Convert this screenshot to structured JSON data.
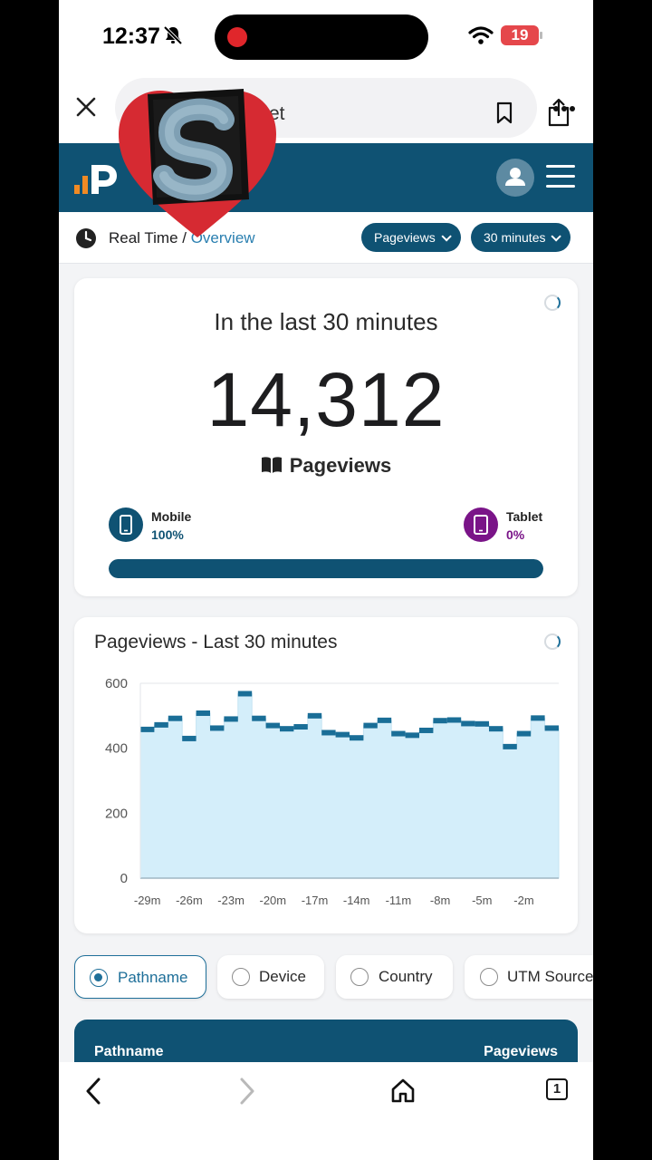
{
  "status_bar": {
    "time": "12:37",
    "battery": "19",
    "silent": true
  },
  "browser": {
    "url_fragment": "et",
    "tab_count": "1"
  },
  "breadcrumb": {
    "section": "Real Time",
    "separator": " / ",
    "page": "Overview"
  },
  "filters": {
    "metric": "Pageviews",
    "range": "30 minutes"
  },
  "summary": {
    "heading": "In the last 30 minutes",
    "total": "14,312",
    "metric_label": "Pageviews",
    "mobile": {
      "label": "Mobile",
      "percent": "100%",
      "fraction": 1.0
    },
    "tablet": {
      "label": "Tablet",
      "percent": "0%",
      "fraction": 0.0
    }
  },
  "chart_data": {
    "type": "area",
    "title": "Pageviews - Last 30 minutes",
    "xlabel": "",
    "ylabel": "",
    "ylim": [
      0,
      600
    ],
    "yticks": [
      "0",
      "200",
      "400",
      "600"
    ],
    "xticks": [
      "-29m",
      "-26m",
      "-23m",
      "-20m",
      "-17m",
      "-14m",
      "-11m",
      "-8m",
      "-5m",
      "-2m"
    ],
    "values": [
      458,
      472,
      492,
      430,
      508,
      462,
      490,
      568,
      492,
      470,
      460,
      466,
      500,
      448,
      442,
      432,
      470,
      486,
      445,
      440,
      455,
      485,
      487,
      476,
      475,
      460,
      405,
      445,
      493,
      462
    ],
    "grid": true,
    "colors": {
      "line": "#1a6e97",
      "fill": "#d4eefa"
    }
  },
  "dimension_tabs": [
    {
      "label": "Pathname",
      "selected": true
    },
    {
      "label": "Device",
      "selected": false
    },
    {
      "label": "Country",
      "selected": false
    },
    {
      "label": "UTM Source",
      "selected": false
    }
  ],
  "table": {
    "col1": "Pathname",
    "col2": "Pageviews"
  },
  "colors": {
    "brand": "#0f5273",
    "link": "#2a7fb0",
    "mobile": "#0f5273",
    "tablet": "#7a1488"
  }
}
